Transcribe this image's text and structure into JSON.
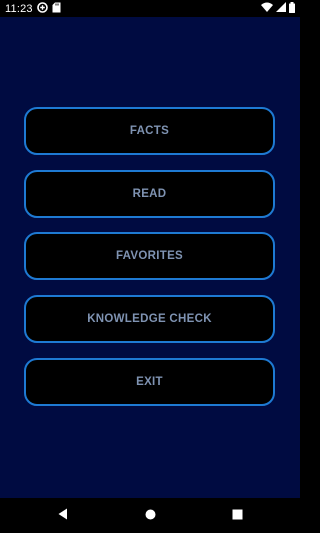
{
  "status_bar": {
    "time": "11:23",
    "icons": [
      "data-saver-icon",
      "sd-card-icon",
      "wifi-icon",
      "signal-icon",
      "battery-icon"
    ]
  },
  "menu": {
    "items": [
      {
        "label": "FACTS"
      },
      {
        "label": "READ"
      },
      {
        "label": "FAVORITES"
      },
      {
        "label": "KNOWLEDGE CHECK"
      },
      {
        "label": "EXIT"
      }
    ]
  },
  "colors": {
    "background": "#000b41",
    "button_fill": "#000000",
    "button_border": "#1e7ad3",
    "button_text": "#7f93b2"
  },
  "nav_bar": {
    "icons": [
      "back-icon",
      "home-icon",
      "recents-icon"
    ]
  }
}
